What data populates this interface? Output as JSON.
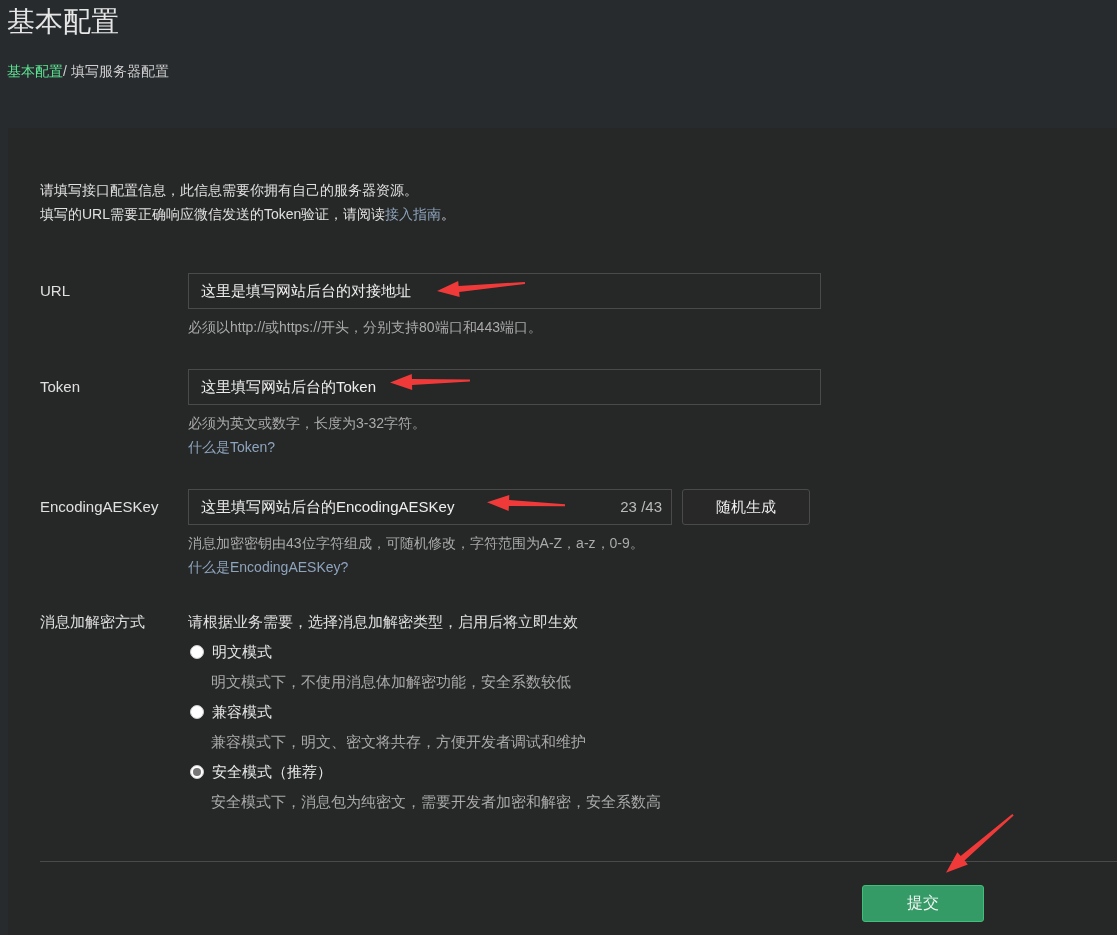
{
  "title": "基本配置",
  "breadcrumb": [
    {
      "label": "基本配置",
      "kind": "link"
    },
    {
      "label": "/ 填写服务器配置",
      "kind": "current"
    }
  ],
  "intro": {
    "line_1": "请填写接口配置信息，此信息需要你拥有自己的服务器资源。",
    "line_2": "填写的URL需要正确响应微信发送的Token验证，请阅读",
    "line_2_link": "接入指南",
    "line_2_end": "。"
  },
  "fields": [
    {
      "kind": "text",
      "label": "URL",
      "value": "这里是填写网站后台的对接地址",
      "hint": "必须以http://或https://开头，分别支持80端口和443端口。"
    },
    {
      "kind": "text",
      "label": "Token",
      "value": "这里填写网站后台的Token",
      "hint": "必须为英文或数字，长度为3-32字符。",
      "help_link": "什么是Token?"
    },
    {
      "kind": "counter",
      "label": "EncodingAESKey",
      "value": "这里填写网站后台的EncodingAESKey",
      "counter": "23 /43",
      "button": "随机生成",
      "hint": "消息加密密钥由43位字符组成，可随机修改，字符范围为A-Z，a-z，0-9。",
      "help_link": "什么是EncodingAESKey?"
    }
  ],
  "encryption": {
    "label": "消息加解密方式",
    "prompt": "请根据业务需要，选择消息加解密类型，启用后将立即生效",
    "options": [
      {
        "label": "明文模式",
        "description": "明文模式下，不使用消息体加解密功能，安全系数较低",
        "selected": false
      },
      {
        "label": "兼容模式",
        "description": "兼容模式下，明文、密文将共存，方便开发者调试和维护",
        "selected": false
      },
      {
        "label": "安全模式（推荐）",
        "description": "安全模式下，消息包为纯密文，需要开发者加密和解密，安全系数高",
        "selected": true
      }
    ]
  },
  "submit": "提交"
}
